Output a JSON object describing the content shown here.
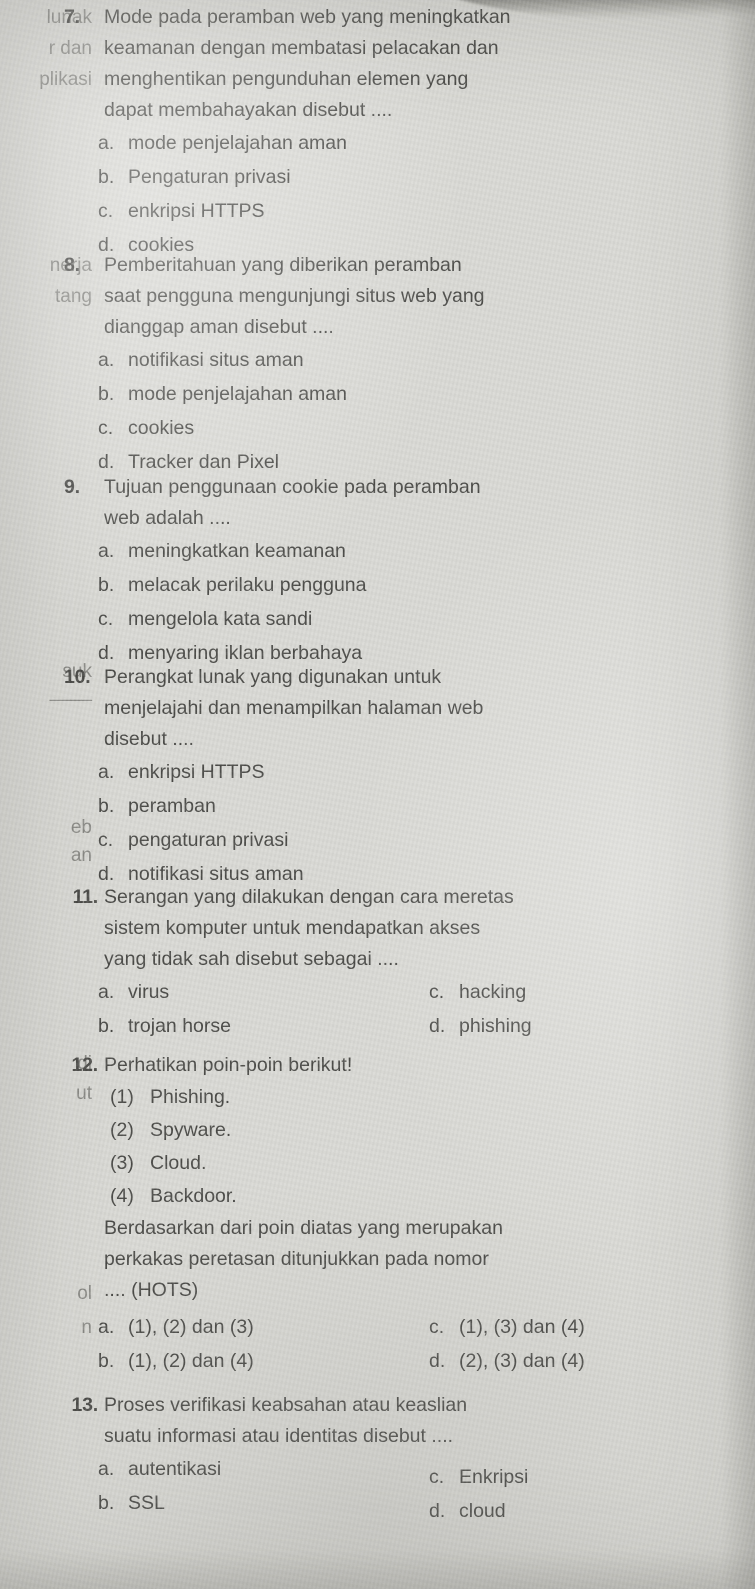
{
  "page": {
    "background_color": "#d9d9d4",
    "ink_color": "#4a4a47",
    "description": "Scanned Indonesian multiple-choice exam page, questions 7 to 13"
  },
  "bleed_fragments": [
    {
      "text": "lunak"
    },
    {
      "text": "r dan"
    },
    {
      "text": "plikasi"
    },
    {
      "text": "nerja"
    },
    {
      "text": "tang"
    },
    {
      "text": "suk"
    },
    {
      "text": "____"
    },
    {
      "text": "eb"
    },
    {
      "text": "an"
    },
    {
      "text": "di"
    },
    {
      "text": "ut"
    },
    {
      "text": "ol"
    },
    {
      "text": "n"
    }
  ],
  "questions": [
    {
      "number": "7.",
      "text": "Mode pada peramban web yang meningkatkan keamanan dengan membatasi pelacakan dan menghentikan pengunduhan elemen yang dapat membahayakan disebut ....",
      "lines": [
        "Mode pada peramban web yang meningkatkan",
        "keamanan dengan membatasi pelacakan dan",
        "menghentikan pengunduhan elemen yang",
        "dapat membahayakan disebut ...."
      ],
      "layout": "single",
      "options": [
        {
          "letter": "a.",
          "text": "mode penjelajahan aman"
        },
        {
          "letter": "b.",
          "text": "Pengaturan privasi"
        },
        {
          "letter": "c.",
          "text": "enkripsi HTTPS"
        },
        {
          "letter": "d.",
          "text": "cookies"
        }
      ]
    },
    {
      "number": "8.",
      "text": "Pemberitahuan yang diberikan peramban saat pengguna mengunjungi situs web yang dianggap aman disebut ....",
      "lines": [
        "Pemberitahuan yang diberikan peramban",
        "saat pengguna mengunjungi situs web yang",
        "dianggap aman disebut ...."
      ],
      "layout": "single",
      "options": [
        {
          "letter": "a.",
          "text": "notifikasi situs aman"
        },
        {
          "letter": "b.",
          "text": "mode penjelajahan aman"
        },
        {
          "letter": "c.",
          "text": "cookies"
        },
        {
          "letter": "d.",
          "text": "Tracker dan Pixel"
        }
      ]
    },
    {
      "number": "9.",
      "text": "Tujuan penggunaan cookie pada peramban web adalah ....",
      "lines": [
        "Tujuan penggunaan cookie pada peramban",
        "web adalah ...."
      ],
      "layout": "single",
      "options": [
        {
          "letter": "a.",
          "text": "meningkatkan keamanan"
        },
        {
          "letter": "b.",
          "text": "melacak perilaku pengguna"
        },
        {
          "letter": "c.",
          "text": "mengelola kata sandi"
        },
        {
          "letter": "d.",
          "text": "menyaring iklan berbahaya"
        }
      ]
    },
    {
      "number": "10.",
      "text": "Perangkat lunak yang digunakan untuk menjelajahi dan menampilkan halaman web disebut ....",
      "lines": [
        "Perangkat lunak yang digunakan untuk",
        "menjelajahi dan menampilkan halaman web",
        "disebut ...."
      ],
      "layout": "single",
      "options": [
        {
          "letter": "a.",
          "text": "enkripsi HTTPS"
        },
        {
          "letter": "b.",
          "text": "peramban"
        },
        {
          "letter": "c.",
          "text": "pengaturan privasi"
        },
        {
          "letter": "d.",
          "text": "notifikasi situs aman"
        }
      ]
    },
    {
      "number": "11.",
      "text": "Serangan yang dilakukan dengan cara meretas sistem komputer untuk mendapatkan akses yang tidak sah disebut sebagai ....",
      "lines": [
        "Serangan yang dilakukan dengan cara meretas",
        "sistem komputer untuk mendapatkan akses",
        "yang tidak sah disebut sebagai ...."
      ],
      "layout": "two-column",
      "options": [
        {
          "letter": "a.",
          "text": "virus"
        },
        {
          "letter": "c.",
          "text": "hacking"
        },
        {
          "letter": "b.",
          "text": "trojan horse"
        },
        {
          "letter": "d.",
          "text": "phishing"
        }
      ]
    },
    {
      "number": "12.",
      "text": "Perhatikan poin-poin berikut!",
      "lines": [
        "Perhatikan poin-poin berikut!"
      ],
      "layout": "two-column",
      "subpoints": [
        {
          "num": "(1)",
          "text": "Phishing."
        },
        {
          "num": "(2)",
          "text": "Spyware."
        },
        {
          "num": "(3)",
          "text": "Cloud."
        },
        {
          "num": "(4)",
          "text": "Backdoor."
        }
      ],
      "continuation_lines": [
        "Berdasarkan dari poin diatas yang merupakan",
        "perkakas peretasan ditunjukkan pada nomor",
        ".... (HOTS)"
      ],
      "options": [
        {
          "letter": "a.",
          "text": "(1), (2) dan (3)"
        },
        {
          "letter": "c.",
          "text": "(1), (3) dan (4)"
        },
        {
          "letter": "b.",
          "text": "(1), (2) dan (4)"
        },
        {
          "letter": "d.",
          "text": "(2), (3) dan (4)"
        }
      ]
    },
    {
      "number": "13.",
      "text": "Proses verifikasi keabsahan atau keaslian suatu informasi atau identitas disebut ....",
      "lines": [
        "Proses verifikasi keabsahan atau keaslian",
        "suatu informasi atau identitas disebut ...."
      ],
      "layout": "two-column-staggered",
      "options": [
        {
          "letter": "a.",
          "text": "autentikasi"
        },
        {
          "letter": "c.",
          "text": "Enkripsi"
        },
        {
          "letter": "b.",
          "text": "SSL"
        },
        {
          "letter": "d.",
          "text": "cloud"
        }
      ]
    }
  ]
}
